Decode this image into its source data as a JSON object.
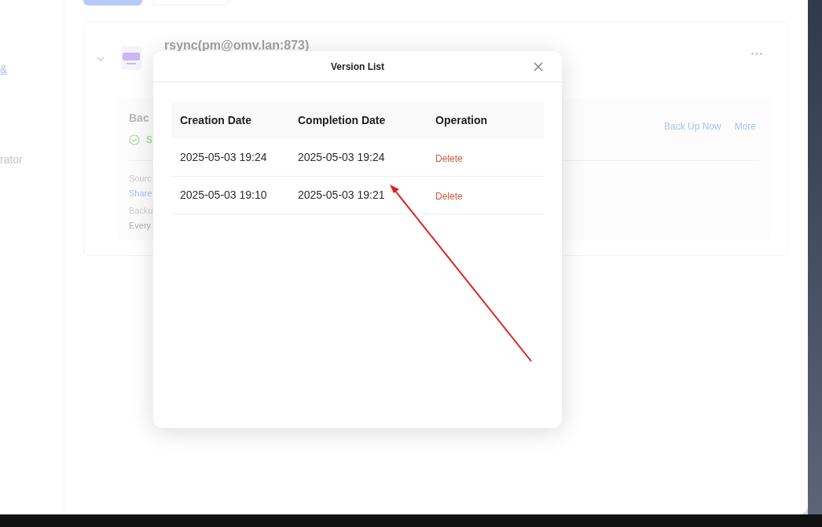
{
  "sidebar": {
    "items": [
      {
        "label": "&",
        "selected": true
      },
      {
        "label": "rator",
        "selected": false
      }
    ]
  },
  "task": {
    "title": "rsync(pm@omv.lan:873)",
    "expanded": true,
    "status_heading": "Bac",
    "status": "S",
    "actions": [
      "Back Up Now",
      "More"
    ],
    "fields": [
      {
        "label": "Sourc",
        "value": "Share",
        "kind": "link"
      },
      {
        "label": "Backu",
        "value": "Every",
        "kind": "text"
      }
    ]
  },
  "dialog": {
    "title": "Version List",
    "columns": [
      "Creation Date",
      "Completion Date",
      "Operation"
    ],
    "rows": [
      {
        "cells": [
          "2025-05-03 19:24",
          "2025-05-03 19:24"
        ],
        "action": "Delete"
      },
      {
        "cells": [
          "2025-05-03 19:10",
          "2025-05-03 19:21"
        ],
        "action": "Delete"
      }
    ]
  }
}
